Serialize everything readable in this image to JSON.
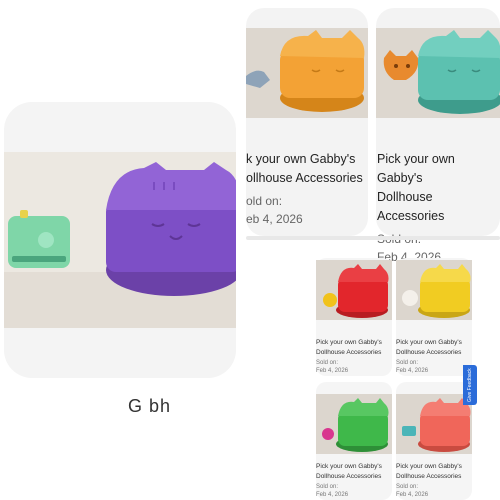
{
  "listing_title_line1": "Pick your own Gabby's",
  "listing_title_line2": "Dollhouse Accessories",
  "mid_title_line1_cropped": "k your own Gabby's",
  "mid_title_line2_cropped": "ollhouse Accessories",
  "mid_sold_cropped": "old on:",
  "date_cropped": "eb 4, 2026",
  "sold_label": "Sold on:",
  "sold_date": "Feb 4, 2026",
  "big_below_text": "G   bh   ",
  "feedback_label": "Give Feedback",
  "colors": {
    "purple_box": "#8a5ad0",
    "orange_box": "#f3a235",
    "teal_box": "#5cc1b0",
    "red_box": "#e2262c",
    "yellow_box": "#f1cc22",
    "green_box": "#3fb84a",
    "coral_box": "#f0665a",
    "mint_toaster": "#7fd6a8",
    "feedback_blue": "#2b6cd9"
  }
}
